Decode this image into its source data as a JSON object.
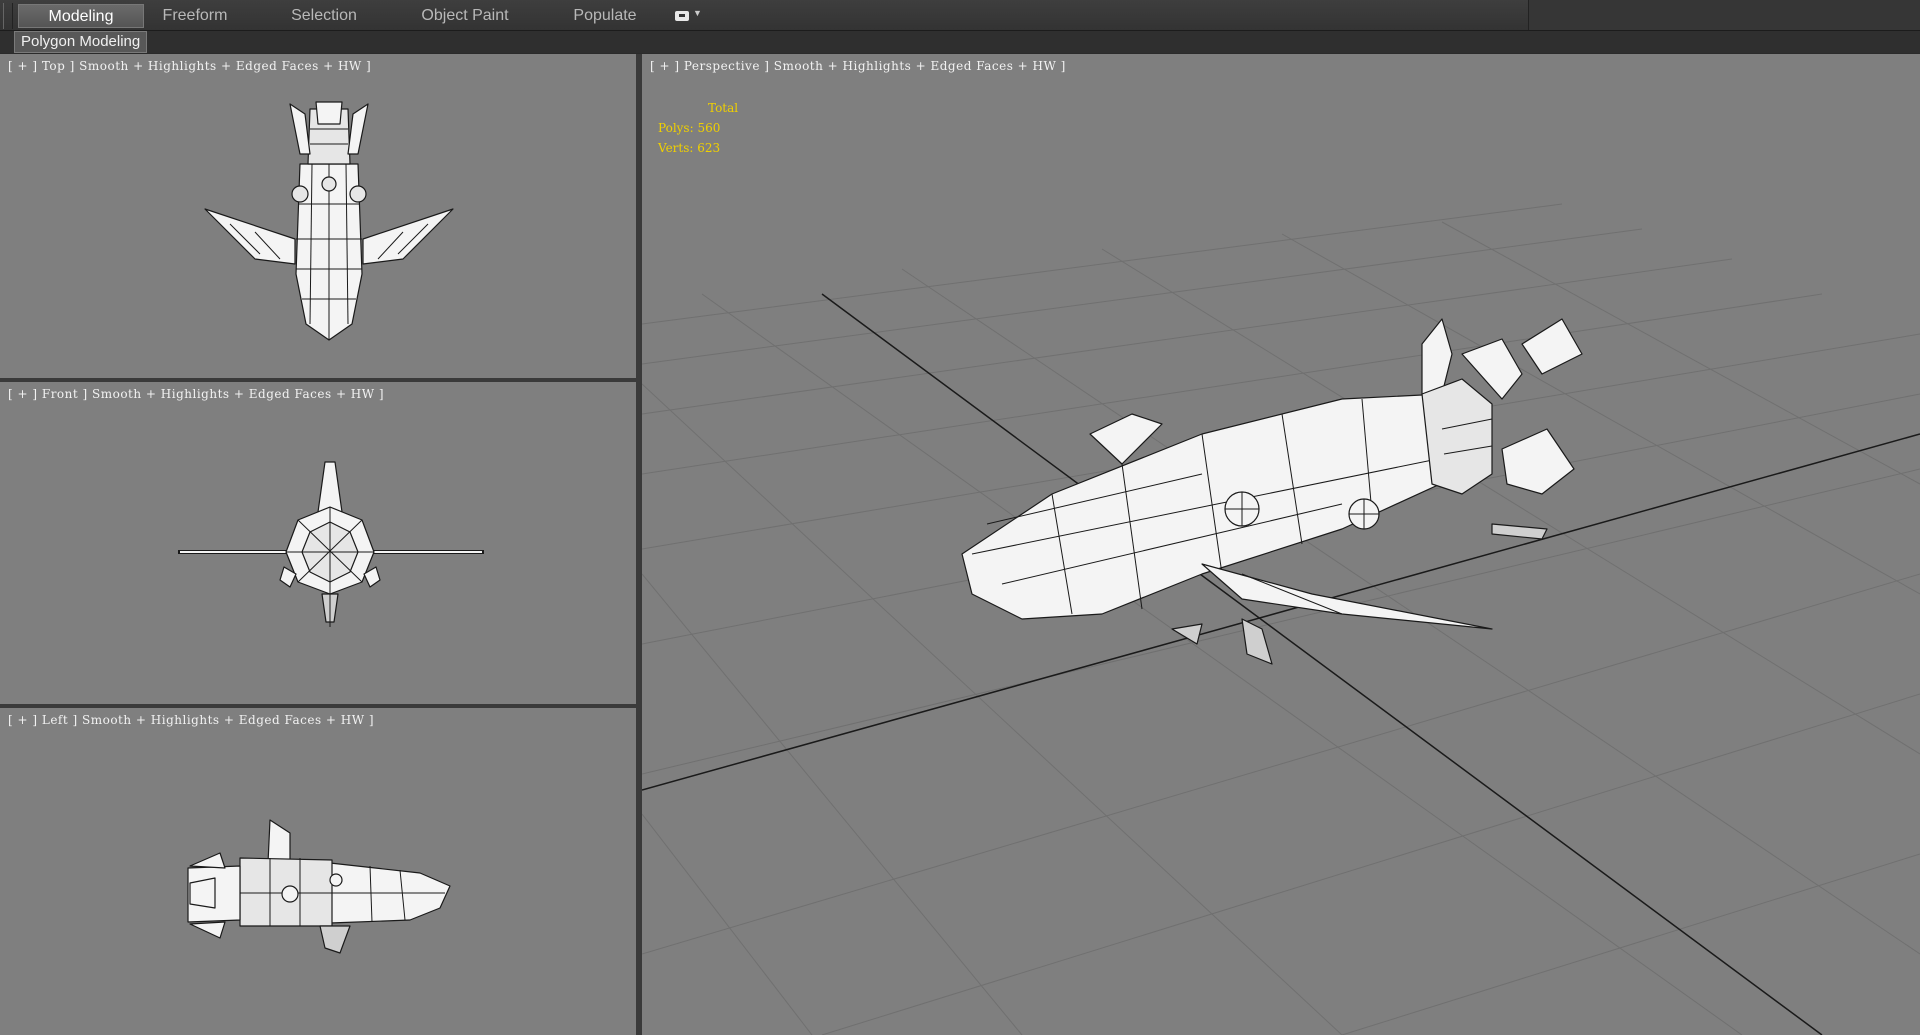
{
  "ribbon": {
    "tabs": [
      {
        "label": "Modeling",
        "active": true
      },
      {
        "label": "Freeform",
        "active": false
      },
      {
        "label": "Selection",
        "active": false
      },
      {
        "label": "Object Paint",
        "active": false
      },
      {
        "label": "Populate",
        "active": false
      }
    ],
    "dropdown_icon": "display-toggle-icon"
  },
  "panel": {
    "label": "Polygon Modeling"
  },
  "viewports": {
    "top": {
      "label": "[ + ] Top ] Smooth + Highlights + Edged Faces + HW ]"
    },
    "front": {
      "label": "[ + ] Front ] Smooth + Highlights + Edged Faces + HW ]"
    },
    "left": {
      "label": "[ + ] Left ] Smooth + Highlights + Edged Faces + HW ]"
    },
    "perspective": {
      "label": "[ + ] Perspective ] Smooth + Highlights + Edged Faces + HW ]",
      "stats": {
        "header": "Total",
        "polys": "Polys: 560",
        "verts": "Verts: 623"
      }
    }
  },
  "colors": {
    "viewport_bg": "#7f7f7f",
    "stats_text": "#f0d000",
    "active_tab": "#5e5e5e"
  }
}
